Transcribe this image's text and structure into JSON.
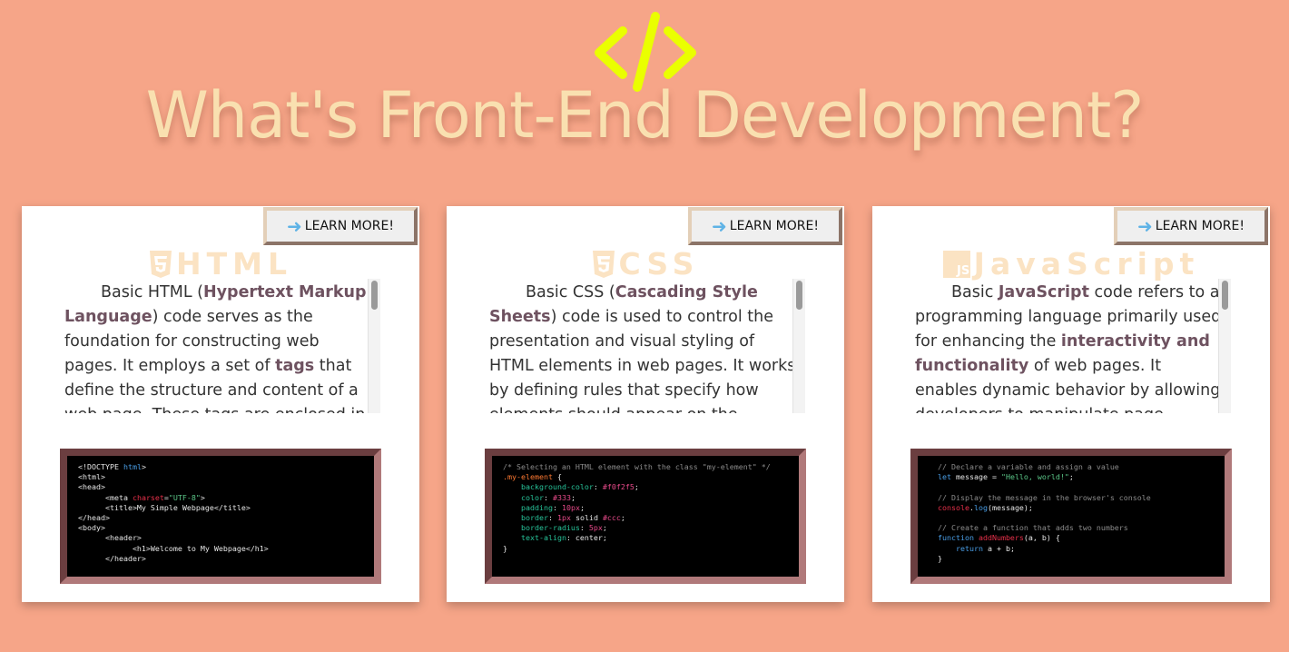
{
  "page": {
    "title": "What's Front-End Development?",
    "accent_color": "#eaff00",
    "background_color": "#f6a588",
    "title_color": "#f9e0b0"
  },
  "cards": [
    {
      "id": "html",
      "button_label": "LEARN MORE!",
      "heading": "HTML",
      "icon": "html5-icon",
      "description_html": "Basic HTML (<b>Hypertext Markup Language</b>) code serves as the foundation for constructing web pages. It employs a set of <b>tags</b> that define the structure and content of a web page. These tags are enclosed in angle brackets.",
      "code_html": "&lt;!DOCTYPE <span class=\"c-kw\">html</span>&gt;\n&lt;html&gt;\n&lt;head&gt;\n      &lt;meta <span class=\"c-red\">charset</span>=<span class=\"c-str\">\"UTF-8\"</span>&gt;\n      &lt;title&gt;My Simple Webpage&lt;/title&gt;\n&lt;/head&gt;\n&lt;body&gt;\n      &lt;header&gt;\n            &lt;h1&gt;Welcome to My Webpage&lt;/h1&gt;\n      &lt;/header&gt;"
    },
    {
      "id": "css",
      "button_label": "LEARN MORE!",
      "heading": "CSS",
      "icon": "css3-icon",
      "description_html": "Basic CSS (<b>Cascading Style Sheets</b>) code is used to control the presentation and visual styling of HTML elements in web pages. It works by defining rules that specify how elements should appear on the screen.",
      "code_html": "<span class=\"c-com\">/* Selecting an HTML element with the class \"my-element\" */</span>\n<span class=\"c-sel\">.my-element</span> {\n    <span class=\"c-prop\">background-color</span>: <span class=\"c-val\">#f0f2f5</span>;\n    <span class=\"c-prop\">color</span>: <span class=\"c-val\">#333</span>;\n    <span class=\"c-prop\">padding</span>: <span class=\"c-val\">10px</span>;\n    <span class=\"c-prop\">border</span>: <span class=\"c-val\">1px</span> solid <span class=\"c-val\">#ccc</span>;\n    <span class=\"c-prop\">border-radius</span>: <span class=\"c-val\">5px</span>;\n    <span class=\"c-prop\">text-align</span>: center;\n}"
    },
    {
      "id": "javascript",
      "button_label": "LEARN MORE!",
      "heading": "JavaScript",
      "icon": "js-icon",
      "description_html": "Basic <b>JavaScript</b> code refers to a programming language primarily used for enhancing the <b>interactivity and functionality</b> of web pages. It enables dynamic behavior by allowing developers to manipulate page content.",
      "code_html": "  <span class=\"c-com\">// Declare a variable and assign a value</span>\n  <span class=\"c-kw\">let</span> message = <span class=\"c-str\">\"Hello, world!\"</span>;\n\n  <span class=\"c-com\">// Display the message in the browser's console</span>\n  <span class=\"c-red\">console</span>.<span class=\"c-kw\">log</span>(message);\n\n  <span class=\"c-com\">// Create a function that adds two numbers</span>\n  <span class=\"c-kw\">function</span> <span class=\"c-red\">addNumbers</span>(a, b) {\n      <span class=\"c-kw\">return</span> a + b;\n  }"
    }
  ]
}
